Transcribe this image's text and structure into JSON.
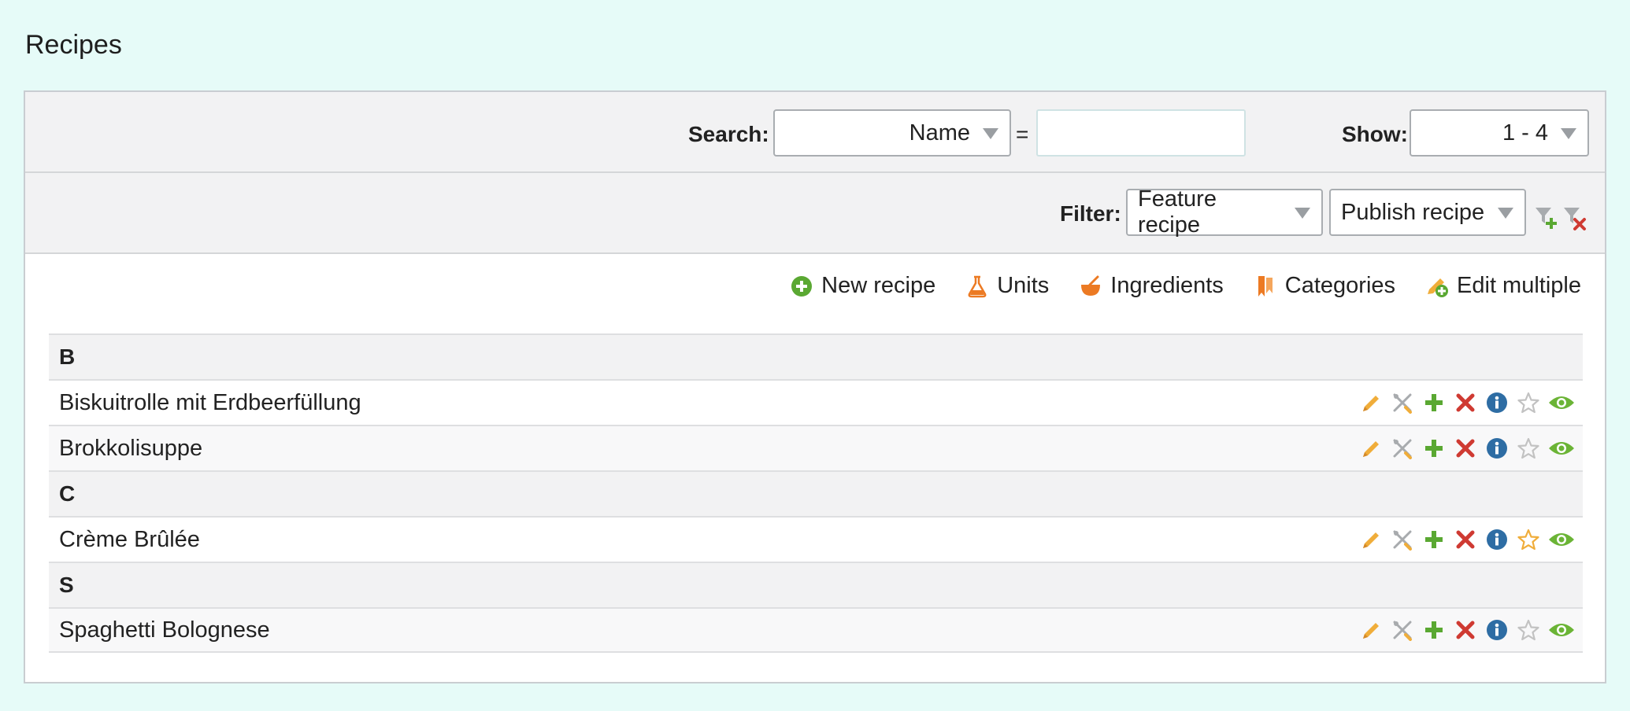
{
  "page": {
    "title": "Recipes"
  },
  "search": {
    "label": "Search:",
    "field_selected": "Name",
    "operator": "=",
    "value": ""
  },
  "show": {
    "label": "Show:",
    "selected": "1 - 4"
  },
  "filter": {
    "label": "Filter:",
    "feature": "Feature recipe",
    "publish": "Publish recipe"
  },
  "toolbar": {
    "new_recipe": "New recipe",
    "units": "Units",
    "ingredients": "Ingredients",
    "categories": "Categories",
    "edit_multiple": "Edit multiple"
  },
  "groups": [
    {
      "letter": "B",
      "items": [
        {
          "name": "Biskuitrolle mit Erdbeerfüllung",
          "featured": false
        },
        {
          "name": "Brokkolisuppe",
          "featured": false
        }
      ]
    },
    {
      "letter": "C",
      "items": [
        {
          "name": "Crème Brûlée",
          "featured": true
        }
      ]
    },
    {
      "letter": "S",
      "items": [
        {
          "name": "Spaghetti Bolognese",
          "featured": false
        }
      ]
    }
  ],
  "row_actions": [
    "pencil-icon",
    "tools-icon",
    "plus-icon",
    "delete-icon",
    "info-icon",
    "star-icon",
    "eye-icon"
  ],
  "colors": {
    "background": "#e6fbf8",
    "edit": "#f0ad3a",
    "add": "#5aa832",
    "delete": "#cf3a32",
    "info": "#2e6da4",
    "view": "#6bb436",
    "featured": "#f0ad3a",
    "not_featured": "#c2c2c2"
  }
}
